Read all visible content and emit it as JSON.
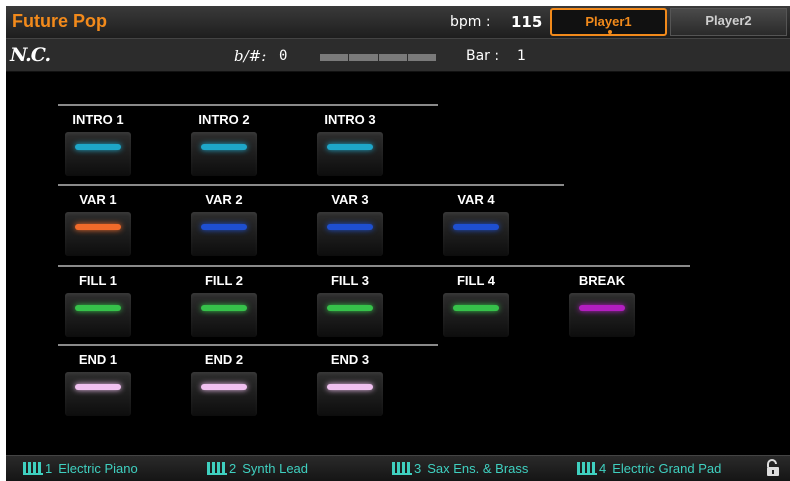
{
  "header": {
    "style_name": "Future Pop",
    "bpm_label": "bpm :",
    "bpm_value": "115",
    "tabs": [
      {
        "label": "Player1",
        "active": true
      },
      {
        "label": "Player2",
        "active": false
      }
    ]
  },
  "subheader": {
    "chord": "N.C.",
    "transpose_label": "b/#:",
    "transpose_value": "0",
    "bar_label": "Bar :",
    "bar_value": "1"
  },
  "groups": {
    "intro": [
      {
        "label": "INTRO 1",
        "led_color": "#1ea6c8"
      },
      {
        "label": "INTRO 2",
        "led_color": "#1ea6c8"
      },
      {
        "label": "INTRO 3",
        "led_color": "#1ea6c8"
      }
    ],
    "variation": [
      {
        "label": "VAR 1",
        "led_color": "#f06a2a"
      },
      {
        "label": "VAR 2",
        "led_color": "#1e4fd0"
      },
      {
        "label": "VAR 3",
        "led_color": "#1e4fd0"
      },
      {
        "label": "VAR 4",
        "led_color": "#1e4fd0"
      }
    ],
    "fill": [
      {
        "label": "FILL 1",
        "led_color": "#36c24a"
      },
      {
        "label": "FILL 2",
        "led_color": "#36c24a"
      },
      {
        "label": "FILL 3",
        "led_color": "#36c24a"
      },
      {
        "label": "FILL 4",
        "led_color": "#36c24a"
      },
      {
        "label": "BREAK",
        "led_color": "#b21ec0"
      }
    ],
    "ending": [
      {
        "label": "END 1",
        "led_color": "#f0c0f0"
      },
      {
        "label": "END 2",
        "led_color": "#f0c0f0"
      },
      {
        "label": "END 3",
        "led_color": "#f0c0f0"
      }
    ]
  },
  "footer": {
    "tracks": [
      {
        "number": "1",
        "name": "Electric Piano"
      },
      {
        "number": "2",
        "name": "Synth Lead"
      },
      {
        "number": "3",
        "name": "Sax Ens. & Brass"
      },
      {
        "number": "4",
        "name": "Electric Grand Pad"
      }
    ],
    "lock_icon": "unlocked-padlock-icon"
  },
  "colors": {
    "accent": "#f28a1b",
    "track_text": "#3fd0c0"
  }
}
